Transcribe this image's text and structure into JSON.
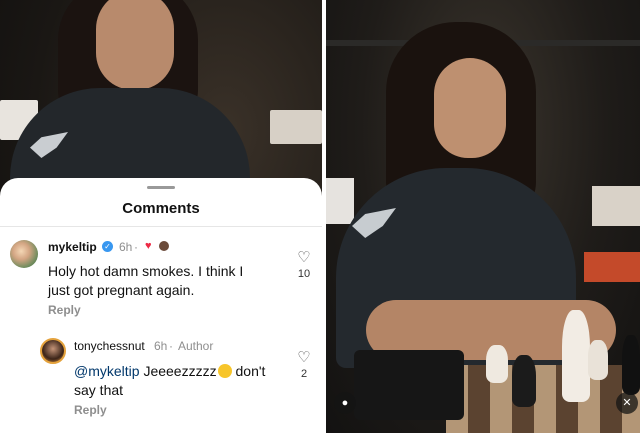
{
  "comments_sheet": {
    "title": "Comments"
  },
  "comments": [
    {
      "username": "mykeltip",
      "verified": true,
      "time": "6h",
      "text": "Holy hot damn smokes. I think I just got pregnant again.",
      "reply_label": "Reply",
      "like_count": "10"
    },
    {
      "username": "tonychessnut",
      "time": "6h",
      "role": "Author",
      "mention": "@mykeltip",
      "text_after_mention": "Jeeeezzzzz",
      "text_end": "don't say that",
      "reply_label": "Reply",
      "like_count": "2"
    }
  ],
  "icons": {
    "verified": "verified-badge-icon",
    "liked_by_creator": "heart-icon",
    "like": "heart-outline-icon",
    "tagged_user": "user-icon",
    "mute": "mute-icon"
  },
  "colors": {
    "verified_blue": "#3897f0",
    "heart_red": "#ed2a45",
    "mention_blue": "#00376b"
  }
}
